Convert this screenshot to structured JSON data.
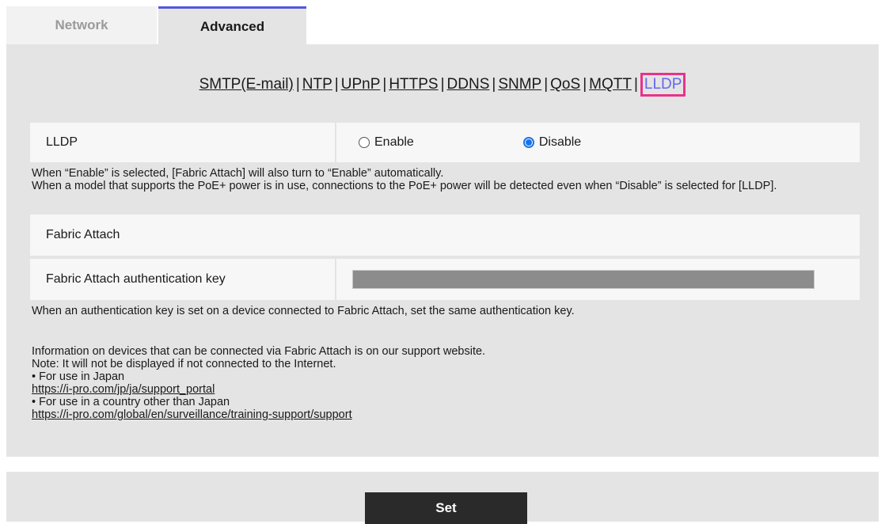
{
  "tabs": [
    {
      "label": "Network",
      "active": false
    },
    {
      "label": "Advanced",
      "active": true
    }
  ],
  "subnav": {
    "items": [
      "SMTP(E-mail)",
      "NTP",
      "UPnP",
      "HTTPS",
      "DDNS",
      "SNMP",
      "QoS",
      "MQTT",
      "LLDP"
    ],
    "separator": "|",
    "current": "LLDP"
  },
  "lldp": {
    "label": "LLDP",
    "options": [
      "Enable",
      "Disable"
    ],
    "selected": "Disable",
    "note1": "When “Enable” is selected, [Fabric Attach] will also turn to “Enable” automatically.",
    "note2": "When a model that supports the PoE+ power is in use, connections to the PoE+ power will be detected even when “Disable” is selected for [LLDP]."
  },
  "fabric_attach": {
    "label": "Fabric Attach"
  },
  "auth_key": {
    "label": "Fabric Attach authentication key",
    "note": "When an authentication key is set on a device connected to Fabric Attach, set the same authentication key."
  },
  "info": {
    "line1": "Information on devices that can be connected via Fabric Attach is on our support website.",
    "line2": "Note: It will not be displayed if not connected to the Internet.",
    "japan_label": "• For use in Japan",
    "japan_link": "https://i-pro.com/jp/ja/support_portal",
    "other_label": "• For use in a country other than Japan",
    "other_link": "https://i-pro.com/global/en/surveillance/training-support/support"
  },
  "set_button": "Set",
  "colors": {
    "panel": "#e4e4e4",
    "row": "#f7f7f7",
    "accent_tab": "#5555dd",
    "current_link": "#6666ee",
    "highlight_border": "#e8338a",
    "radio_selected": "#1a73e8",
    "button": "#2a2a2a"
  }
}
